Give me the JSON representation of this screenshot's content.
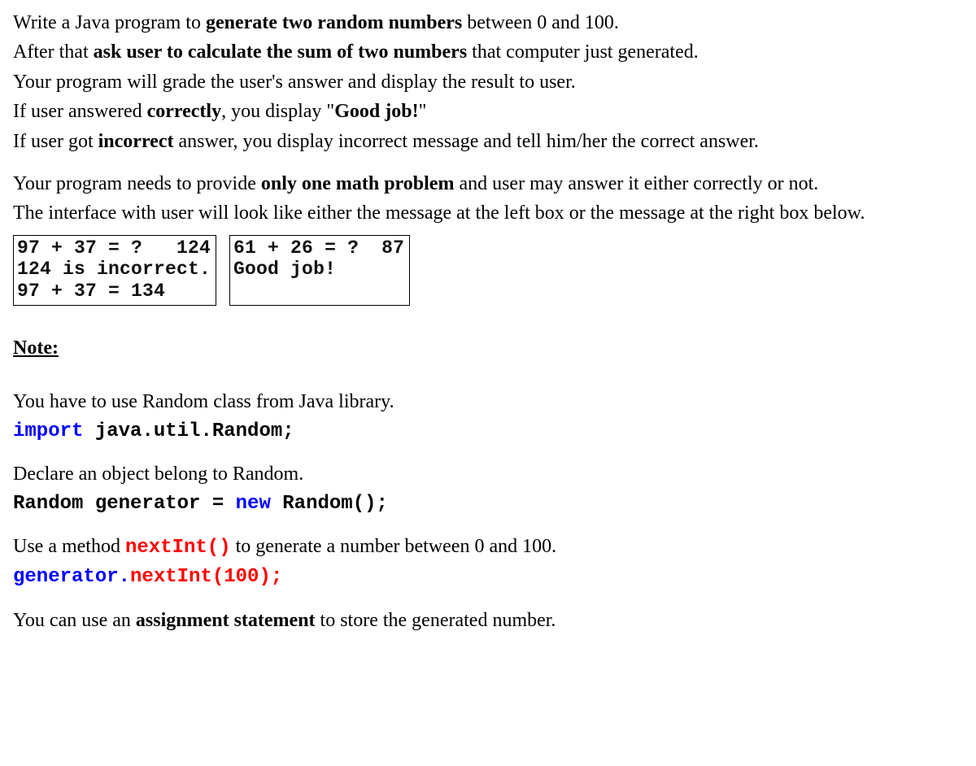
{
  "p1": {
    "a": "Write a Java program to ",
    "b": "generate two random numbers",
    "c": " between 0 and 100."
  },
  "p2": {
    "a": "After that ",
    "b": "ask user to calculate the sum of two numbers",
    "c": " that computer just generated."
  },
  "p3": "Your program will grade the user's answer and display the result to user.",
  "p4": {
    "a": "If user answered ",
    "b": "correctly",
    "c": ", you display \"",
    "d": "Good job!",
    "e": "\""
  },
  "p5": {
    "a": "If user got ",
    "b": "incorrect",
    "c": " answer, you display incorrect message and tell him/her the correct answer."
  },
  "p6": {
    "a": "Your program needs to provide ",
    "b": "only one math problem",
    "c": " and user may answer it either correctly or not."
  },
  "p7": "The interface with user will look like either the message at the left box or the message at the right box below.",
  "boxes": {
    "left": "97 + 37 = ?   124\n124 is incorrect.\n97 + 37 = 134",
    "right": "61 + 26 = ?  87\nGood job!"
  },
  "note_heading": "Note:",
  "n1": "You have to use Random class from Java library.",
  "code1": {
    "a": "import ",
    "b": "java.util.Random;"
  },
  "n2": "Declare an object belong to Random.",
  "code2": {
    "a": " Random generator = ",
    "b": "new",
    "c": " Random();"
  },
  "n3": {
    "a": "Use a method ",
    "b": "nextInt()",
    "c": " to generate a number between 0 and 100."
  },
  "code3": {
    "a": "generator.",
    "b": "nextInt(100);"
  },
  "n4": {
    "a": "You can use an ",
    "b": "assignment statement",
    "c": " to store the generated number."
  }
}
